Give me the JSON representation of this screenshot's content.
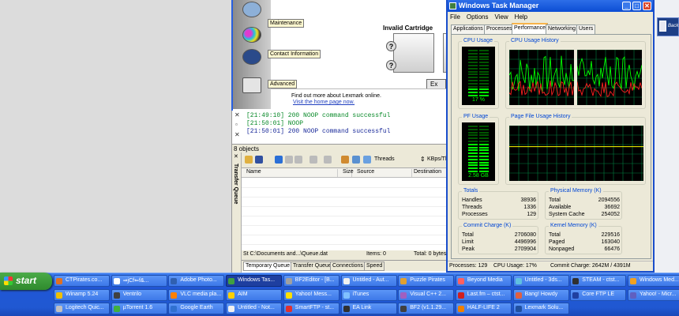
{
  "lexmark": {
    "sidebar": [
      {
        "label": "Maintenance",
        "color": "#6a8fc0"
      },
      {
        "label": "Contact Information",
        "color": "#3a5a9a"
      },
      {
        "label": "Advanced",
        "color": "#7a7a7a"
      }
    ],
    "cartridge_label": "Invalid Cartridge",
    "exit_label": "Ex",
    "find_more": "Find out more about Lexmark online.",
    "visit_link": "Visit the home page now."
  },
  "ftp": {
    "log": [
      {
        "text": "[21:49:10] 200 NOOP command successful",
        "kind": "resp"
      },
      {
        "text": "[21:50:01] NOOP",
        "kind": "cmd"
      },
      {
        "text": "[21:50:01] 200 NOOP command successful",
        "kind": "resp"
      }
    ],
    "object_count": "8 objects",
    "transfer_queue_label": "Transfer Queue",
    "toolbar_threads": "Threads",
    "toolbar_speed": "KBps/Thre",
    "columns": [
      "Name",
      "Size",
      "Source",
      "Destination"
    ],
    "status_path": "St  C:\\Documents and...\\Queue.dat",
    "status_items": "Items: 0",
    "status_total": "Total: 0 bytes",
    "tabs": [
      "Temporary Queue",
      "Transfer Queue",
      "Connections",
      "Speed"
    ]
  },
  "taskmgr": {
    "title": "Windows Task Manager",
    "menu": [
      "File",
      "Options",
      "View",
      "Help"
    ],
    "tabs": [
      "Applications",
      "Processes",
      "Performance",
      "Networking",
      "Users"
    ],
    "active_tab": "Performance",
    "cpu_usage": {
      "title": "CPU Usage",
      "value": "17 %",
      "fraction": 0.17
    },
    "cpu_history": {
      "title": "CPU Usage History"
    },
    "pf_usage": {
      "title": "PF Usage",
      "value": "2.58 GB",
      "fraction": 0.62
    },
    "pf_history": {
      "title": "Page File Usage History"
    },
    "totals": {
      "title": "Totals",
      "rows": [
        {
          "k": "Handles",
          "v": "38936"
        },
        {
          "k": "Threads",
          "v": "1336"
        },
        {
          "k": "Processes",
          "v": "129"
        }
      ]
    },
    "physical": {
      "title": "Physical Memory (K)",
      "rows": [
        {
          "k": "Total",
          "v": "2094556"
        },
        {
          "k": "Available",
          "v": "36692"
        },
        {
          "k": "System Cache",
          "v": "254052"
        }
      ]
    },
    "commit": {
      "title": "Commit Charge (K)",
      "rows": [
        {
          "k": "Total",
          "v": "2706080"
        },
        {
          "k": "Limit",
          "v": "4496996"
        },
        {
          "k": "Peak",
          "v": "2709904"
        }
      ]
    },
    "kernel": {
      "title": "Kernel Memory (K)",
      "rows": [
        {
          "k": "Total",
          "v": "229516"
        },
        {
          "k": "Paged",
          "v": "163040"
        },
        {
          "k": "Nonpaged",
          "v": "66476"
        }
      ]
    },
    "status": {
      "processes": "Processes: 129",
      "cpu": "CPU Usage: 17%",
      "commit": "Commit Charge: 2642M / 4391M"
    }
  },
  "right_tile": {
    "text": "Back"
  },
  "taskbar": {
    "start_label": "start",
    "row1": [
      {
        "label": "CTPirates.co...",
        "color": "#e07020"
      },
      {
        "label": "⇒jCf⇐f&...",
        "color": "#ffffff"
      },
      {
        "label": "Adobe Photo...",
        "color": "#3060b0"
      },
      {
        "label": "Windows Tas...",
        "color": "#40a040",
        "active": true
      },
      {
        "label": "BF2Editor - [B...",
        "color": "#a0a0a0"
      },
      {
        "label": "Untitled - Aut...",
        "color": "#f0f0f0"
      },
      {
        "label": "Puzzle Pirates",
        "color": "#e0a030"
      },
      {
        "label": "Beyond Media",
        "color": "#ff6060"
      },
      {
        "label": "Untitled - 3ds...",
        "color": "#60c0e0"
      },
      {
        "label": "STEAM - ctst...",
        "color": "#303030"
      },
      {
        "label": "Windows Med...",
        "color": "#f0a020"
      }
    ],
    "row2": [
      {
        "label": "Winamp 5.24",
        "color": "#f0c000"
      },
      {
        "label": "Ventrilo",
        "color": "#404040"
      },
      {
        "label": "VLC media pla...",
        "color": "#ff8000"
      },
      {
        "label": "AIM",
        "color": "#ffd000"
      },
      {
        "label": "Yahoo! Mess...",
        "color": "#ffe000"
      },
      {
        "label": "iTunes",
        "color": "#80c0ff"
      },
      {
        "label": "Visual C++ 2...",
        "color": "#a060c0"
      },
      {
        "label": "Last.fm – ctst...",
        "color": "#d02020"
      },
      {
        "label": "Bang! Howdy",
        "color": "#e06040"
      },
      {
        "label": "Core FTP LE",
        "color": "#2040a0"
      },
      {
        "label": "Yahoo! - Micr...",
        "color": "#6060c0"
      }
    ],
    "row3": [
      {
        "label": "Logitech Quic...",
        "color": "#c0c0c0"
      },
      {
        "label": "µTorrent 1.6",
        "color": "#40b040"
      },
      {
        "label": "Google Earth",
        "color": "#3070d0"
      },
      {
        "label": "Untitled - Not...",
        "color": "#f0f0f0"
      },
      {
        "label": "SmartFTP - st...",
        "color": "#e03030"
      },
      {
        "label": "EA Link",
        "color": "#303030"
      },
      {
        "label": "BF2 (v1.1.29...",
        "color": "#404040"
      },
      {
        "label": "HALF-LIFE 2",
        "color": "#f08000"
      },
      {
        "label": "Lexmark Solu...",
        "color": "#2050a0"
      }
    ]
  }
}
